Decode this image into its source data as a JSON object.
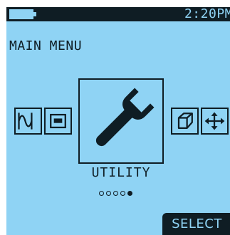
{
  "status_bar": {
    "battery_icon": "battery-icon",
    "time": "2:20PM"
  },
  "menu": {
    "title": "MAIN MENU",
    "items": [
      {
        "icon": "waveform-icon"
      },
      {
        "icon": "display-icon"
      },
      {
        "icon": "wrench-icon",
        "label": "UTILITY",
        "selected": true
      },
      {
        "icon": "cube-icon"
      },
      {
        "icon": "arrows-icon"
      }
    ],
    "page_indicator": {
      "total": 5,
      "current": 5
    }
  },
  "softkey": {
    "label": "SELECT"
  },
  "colors": {
    "screen_bg": "#8fd3f4",
    "ink": "#0f1d24"
  }
}
